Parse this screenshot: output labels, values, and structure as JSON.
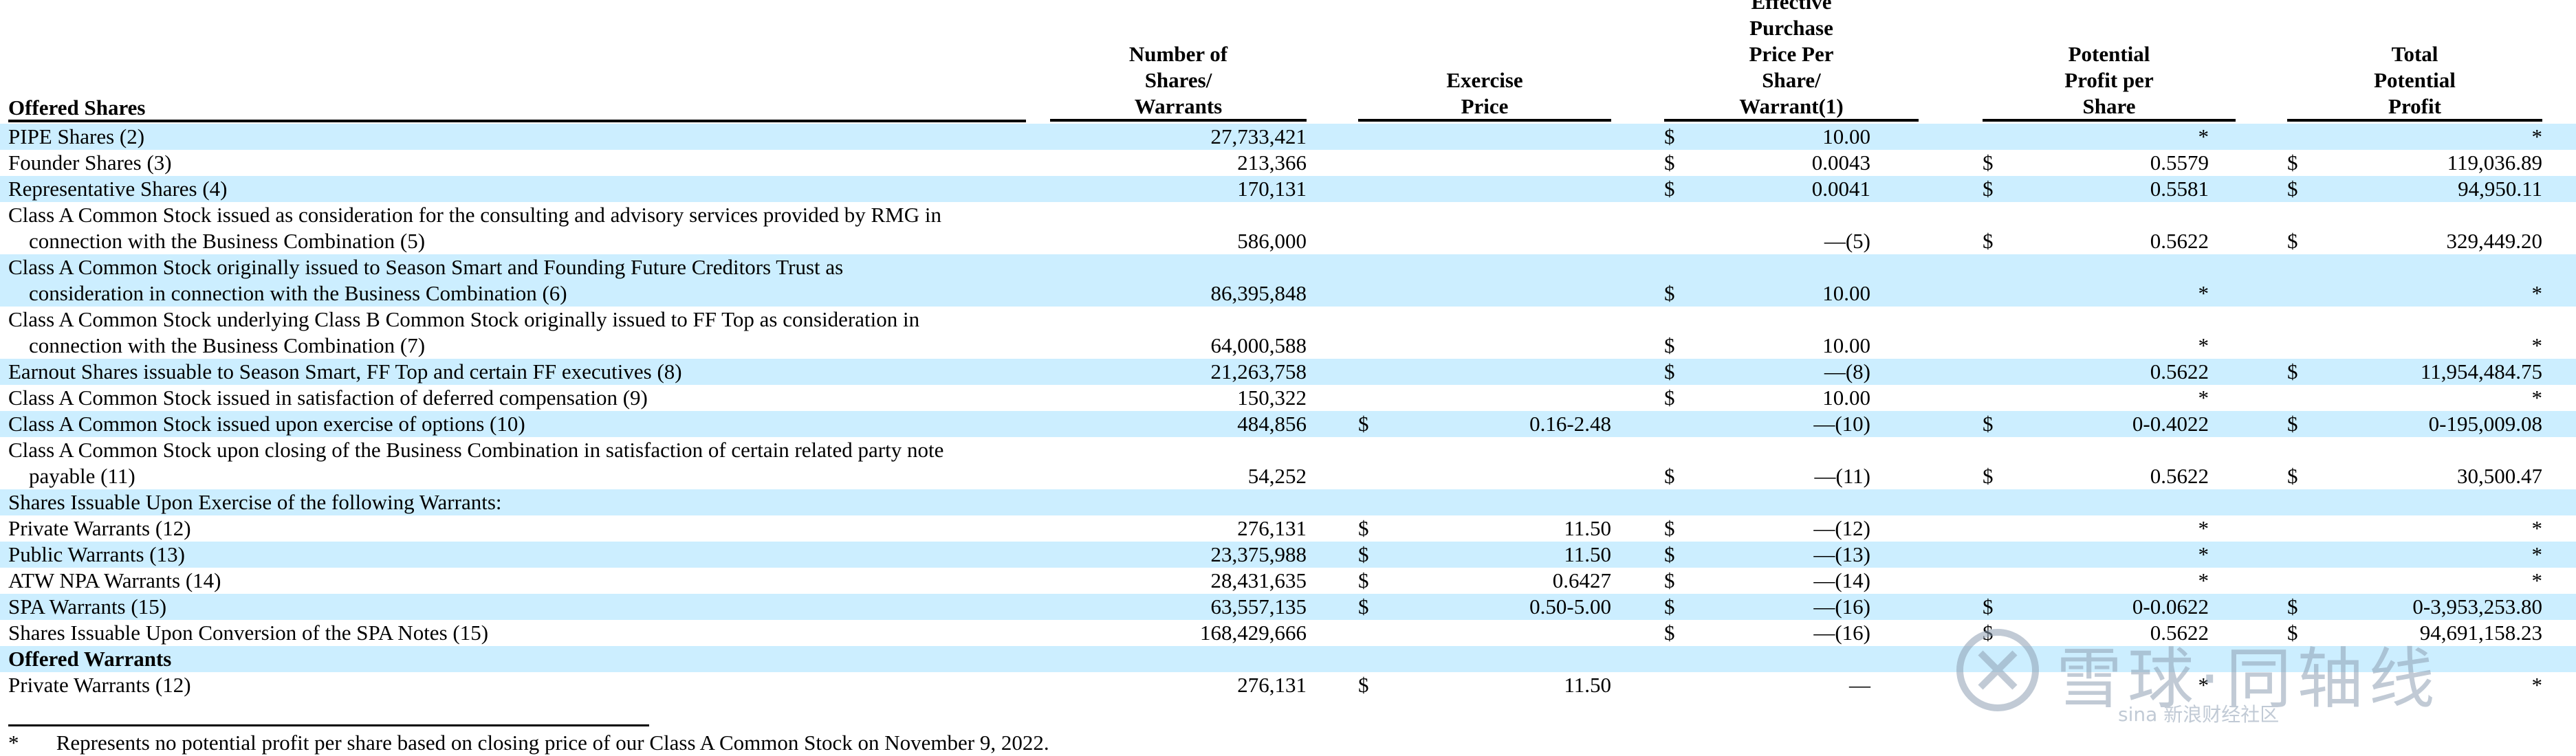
{
  "header": {
    "offered": "Offered Shares",
    "col_number": [
      "Number of",
      "Shares/",
      "Warrants"
    ],
    "col_exercise": [
      "Exercise",
      "Price"
    ],
    "col_effective": [
      "Effective",
      "Purchase",
      "Price Per",
      "Share/",
      "Warrant(1)"
    ],
    "col_profit": [
      "Potential",
      "Profit per",
      "Share"
    ],
    "col_total": [
      "Total",
      "Potential",
      "Profit"
    ]
  },
  "rows": [
    {
      "label": [
        "PIPE Shares (2)"
      ],
      "number": "27,733,421",
      "ex_dollar": "",
      "exercise": "",
      "ep_dollar": "$",
      "effective": "10.00",
      "pp_dollar": "",
      "profit": "*",
      "tp_dollar": "",
      "total": "*",
      "shade": true
    },
    {
      "label": [
        "Founder Shares (3)"
      ],
      "number": "213,366",
      "ex_dollar": "",
      "exercise": "",
      "ep_dollar": "$",
      "effective": "0.0043",
      "pp_dollar": "$",
      "profit": "0.5579",
      "tp_dollar": "$",
      "total": "119,036.89",
      "shade": false
    },
    {
      "label": [
        "Representative Shares (4)"
      ],
      "number": "170,131",
      "ex_dollar": "",
      "exercise": "",
      "ep_dollar": "$",
      "effective": "0.0041",
      "pp_dollar": "$",
      "profit": "0.5581",
      "tp_dollar": "$",
      "total": "94,950.11",
      "shade": true
    },
    {
      "label": [
        "Class A Common Stock issued as consideration for the consulting and advisory services provided by RMG in",
        "connection with the Business Combination (5)"
      ],
      "number": "586,000",
      "ex_dollar": "",
      "exercise": "",
      "ep_dollar": "",
      "effective": "—(5)",
      "pp_dollar": "$",
      "profit": "0.5622",
      "tp_dollar": "$",
      "total": "329,449.20",
      "shade": false
    },
    {
      "label": [
        "Class A Common Stock originally issued to Season Smart and Founding Future Creditors Trust as",
        "consideration in connection with the Business Combination (6)"
      ],
      "number": "86,395,848",
      "ex_dollar": "",
      "exercise": "",
      "ep_dollar": "$",
      "effective": "10.00",
      "pp_dollar": "",
      "profit": "*",
      "tp_dollar": "",
      "total": "*",
      "shade": true
    },
    {
      "label": [
        "Class A Common Stock underlying Class B Common Stock originally issued to FF Top as consideration in",
        "connection with the Business Combination (7)"
      ],
      "number": "64,000,588",
      "ex_dollar": "",
      "exercise": "",
      "ep_dollar": "$",
      "effective": "10.00",
      "pp_dollar": "",
      "profit": "*",
      "tp_dollar": "",
      "total": "*",
      "shade": false
    },
    {
      "label": [
        "Earnout Shares issuable to Season Smart, FF Top and certain FF executives (8)"
      ],
      "number": "21,263,758",
      "ex_dollar": "",
      "exercise": "",
      "ep_dollar": "$",
      "effective": "—(8)",
      "pp_dollar": "",
      "profit": "0.5622",
      "tp_dollar": "$",
      "total": "11,954,484.75",
      "shade": true
    },
    {
      "label": [
        "Class A Common Stock issued in satisfaction of deferred compensation (9)"
      ],
      "number": "150,322",
      "ex_dollar": "",
      "exercise": "",
      "ep_dollar": "$",
      "effective": "10.00",
      "pp_dollar": "",
      "profit": "*",
      "tp_dollar": "",
      "total": "*",
      "shade": false
    },
    {
      "label": [
        "Class A Common Stock issued upon exercise of options (10)"
      ],
      "number": "484,856",
      "ex_dollar": "$",
      "exercise": "0.16-2.48",
      "ep_dollar": "",
      "effective": "—(10)",
      "pp_dollar": "$",
      "profit": "0-0.4022",
      "tp_dollar": "$",
      "total": "0-195,009.08",
      "shade": true
    },
    {
      "label": [
        "Class A Common Stock upon closing of the Business Combination in satisfaction of certain related party note",
        "payable (11)"
      ],
      "number": "54,252",
      "ex_dollar": "",
      "exercise": "",
      "ep_dollar": "$",
      "effective": "—(11)",
      "pp_dollar": "$",
      "profit": "0.5622",
      "tp_dollar": "$",
      "total": "30,500.47",
      "shade": false
    },
    {
      "label": [
        "Shares Issuable Upon Exercise of the following Warrants:"
      ],
      "number": "",
      "ex_dollar": "",
      "exercise": "",
      "ep_dollar": "",
      "effective": "",
      "pp_dollar": "",
      "profit": "",
      "tp_dollar": "",
      "total": "",
      "shade": true
    },
    {
      "label": [
        "Private Warrants (12)"
      ],
      "number": "276,131",
      "ex_dollar": "$",
      "exercise": "11.50",
      "ep_dollar": "$",
      "effective": "—(12)",
      "pp_dollar": "",
      "profit": "*",
      "tp_dollar": "",
      "total": "*",
      "shade": false
    },
    {
      "label": [
        "Public Warrants (13)"
      ],
      "number": "23,375,988",
      "ex_dollar": "$",
      "exercise": "11.50",
      "ep_dollar": "$",
      "effective": "—(13)",
      "pp_dollar": "",
      "profit": "*",
      "tp_dollar": "",
      "total": "*",
      "shade": true
    },
    {
      "label": [
        "ATW NPA Warrants (14)"
      ],
      "number": "28,431,635",
      "ex_dollar": "$",
      "exercise": "0.6427",
      "ep_dollar": "$",
      "effective": "—(14)",
      "pp_dollar": "",
      "profit": "*",
      "tp_dollar": "",
      "total": "*",
      "shade": false
    },
    {
      "label": [
        "SPA Warrants (15)"
      ],
      "number": "63,557,135",
      "ex_dollar": "$",
      "exercise": "0.50-5.00",
      "ep_dollar": "$",
      "effective": "—(16)",
      "pp_dollar": "$",
      "profit": "0-0.0622",
      "tp_dollar": "$",
      "total": "0-3,953,253.80",
      "shade": true
    },
    {
      "label": [
        "Shares Issuable Upon Conversion of the SPA Notes (15)"
      ],
      "number": "168,429,666",
      "ex_dollar": "",
      "exercise": "",
      "ep_dollar": "$",
      "effective": "—(16)",
      "pp_dollar": "$",
      "profit": "0.5622",
      "tp_dollar": "$",
      "total": "94,691,158.23",
      "shade": false
    },
    {
      "label": [
        "Offered Warrants"
      ],
      "number": "",
      "ex_dollar": "",
      "exercise": "",
      "ep_dollar": "",
      "effective": "",
      "pp_dollar": "",
      "profit": "",
      "tp_dollar": "",
      "total": "",
      "shade": true,
      "bold": true
    },
    {
      "label": [
        "Private Warrants (12)"
      ],
      "number": "276,131",
      "ex_dollar": "$",
      "exercise": "11.50",
      "ep_dollar": "",
      "effective": "—",
      "pp_dollar": "",
      "profit": "*",
      "tp_dollar": "",
      "total": "*",
      "shade": false
    }
  ],
  "footnote": {
    "marker": "*",
    "text": "Represents no potential profit per share based on closing price of our Class A Common Stock on November 9, 2022."
  },
  "watermark": {
    "main": "雪球·同轴线",
    "sub": "新浪财经社区",
    "brand": "sina"
  },
  "colors": {
    "row_shade": "#cceeff",
    "watermark": "#8fa0b4"
  }
}
